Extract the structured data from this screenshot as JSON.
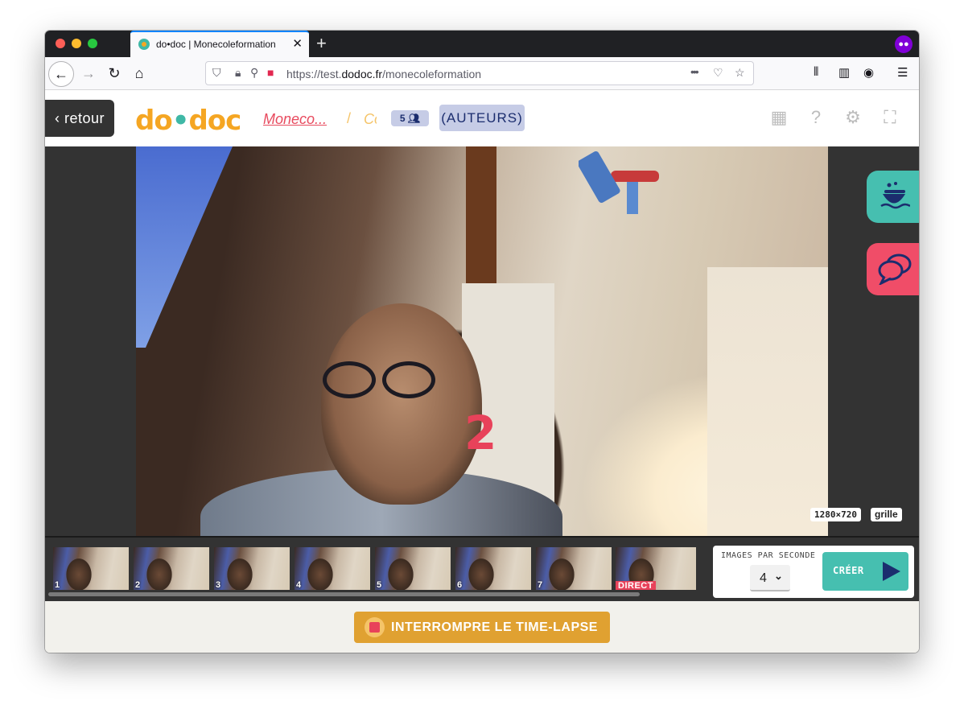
{
  "browser": {
    "tab_title": "do•doc | Monecoleformation",
    "new_tab_label": "+",
    "url_prefix": "https://test.",
    "url_domain": "dodoc.fr",
    "url_path": "/monecoleformation",
    "page_actions_label": "•••"
  },
  "header": {
    "back_label": "‹ retour",
    "logo_part1": "do",
    "logo_part2": "doc",
    "breadcrumb_project": "Moneco...",
    "breadcrumb_separator": "/",
    "breadcrumb_current": "Co",
    "authors_count": "5",
    "authors_label": "(AUTEURS)"
  },
  "stage": {
    "countdown": "2",
    "resolution": "1280×720",
    "grid_label": "grille"
  },
  "filmstrip": {
    "frames": [
      "1",
      "2",
      "3",
      "4",
      "5",
      "6",
      "7"
    ],
    "live_label": "DIRECT"
  },
  "controls": {
    "fps_label": "IMAGES PAR SECONDE",
    "fps_value": "4",
    "create_label": "CRÉER"
  },
  "footer": {
    "stop_label": "INTERROMPRE LE TIME-LAPSE"
  },
  "colors": {
    "accent_teal": "#46bfb0",
    "accent_pink": "#f04d68",
    "accent_orange": "#e0a131",
    "brand_navy": "#1b2d6e"
  }
}
